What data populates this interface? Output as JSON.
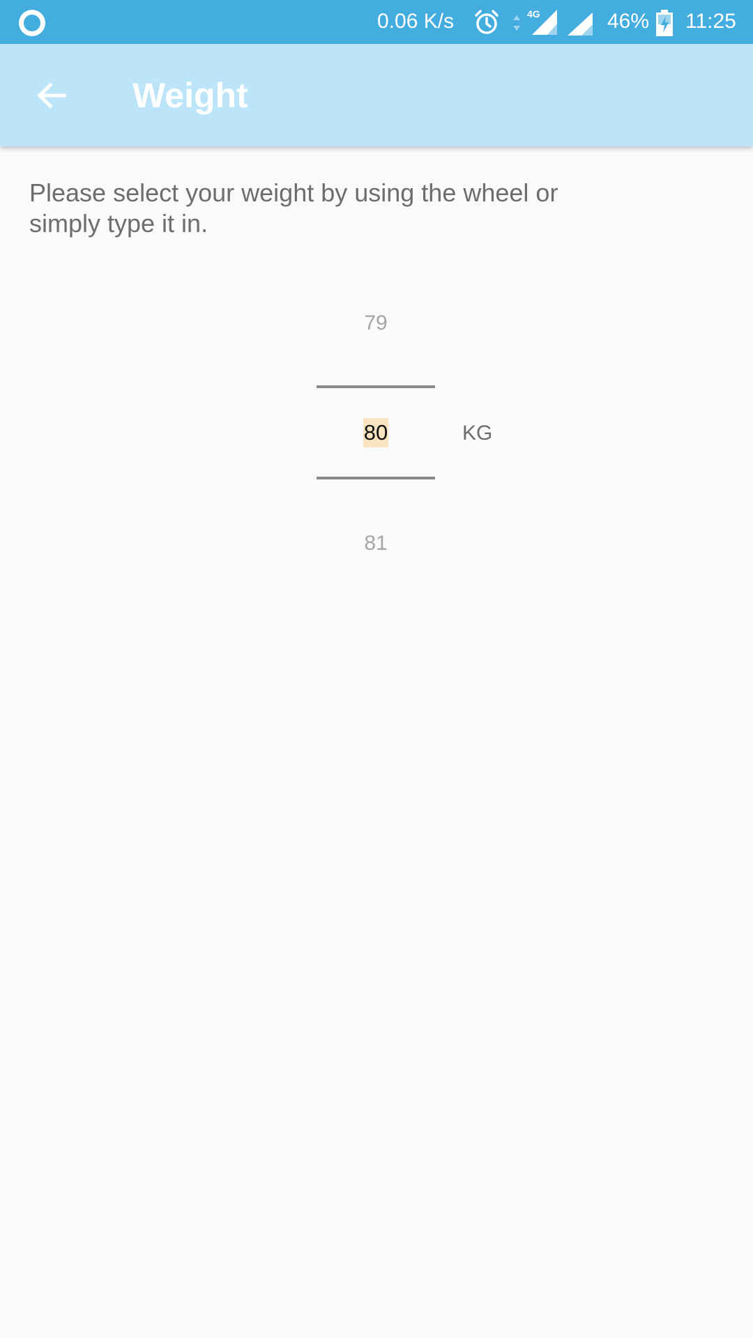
{
  "status_bar": {
    "net_speed": "0.06 K/s",
    "network_type": "4G",
    "battery": "46%",
    "time": "11:25",
    "icons": [
      "circle-notification-icon",
      "alarm-icon",
      "data-arrows-icon",
      "signal-4g-icon",
      "signal-icon",
      "battery-charging-icon"
    ]
  },
  "app_bar": {
    "back_icon": "arrow-back-icon",
    "title": "Weight"
  },
  "content": {
    "instructions": "Please select your weight by using the wheel or simply type it in.",
    "picker": {
      "previous": "79",
      "current": "80",
      "next": "81",
      "unit": "KG"
    }
  },
  "colors": {
    "status_bar": "#43ade0",
    "app_bar": "#bde5f9",
    "background": "#fafafa",
    "selected_highlight": "#fae3bf"
  }
}
